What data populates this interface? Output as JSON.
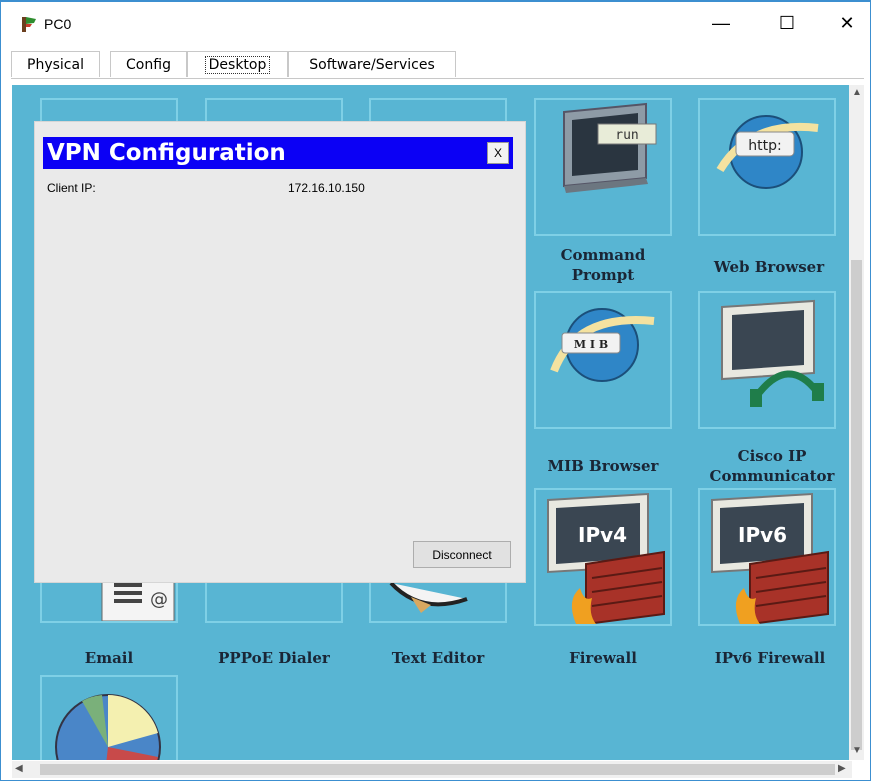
{
  "window": {
    "title": "PC0",
    "minimize_glyph": "—",
    "maximize_glyph": "☐",
    "close_glyph": "✕"
  },
  "tabs": [
    {
      "label": "Physical"
    },
    {
      "label": "Config"
    },
    {
      "label": "Desktop"
    },
    {
      "label": "Software/Services"
    }
  ],
  "tiles": [
    {
      "label": "Email",
      "icon": "email-icon"
    },
    {
      "label": "PPPoE Dialer",
      "icon": "pppoe-icon"
    },
    {
      "label": "Text Editor",
      "icon": "text-editor-icon"
    },
    {
      "label": "Command Prompt",
      "icon": "command-prompt-icon",
      "icon_text": "run"
    },
    {
      "label": "Web Browser",
      "icon": "web-browser-icon",
      "icon_text": "http:"
    },
    {
      "label": "MIB Browser",
      "icon": "mib-browser-icon",
      "icon_text": "M I B"
    },
    {
      "label": "Cisco IP Communicator",
      "icon": "ip-communicator-icon"
    },
    {
      "label": "Firewall",
      "icon": "firewall-icon",
      "icon_text": "IPv4"
    },
    {
      "label": "IPv6 Firewall",
      "icon": "ipv6-firewall-icon",
      "icon_text": "IPv6"
    },
    {
      "label": "",
      "icon": "traffic-generator-icon"
    }
  ],
  "vpn": {
    "title": "VPN Configuration",
    "close_label": "X",
    "client_ip_label": "Client IP:",
    "client_ip_value": "172.16.10.150",
    "disconnect_label": "Disconnect"
  },
  "colors": {
    "desktop_bg": "#58b5d3",
    "vpn_header": "#0b00f5",
    "window_border": "#3c8fd0"
  }
}
